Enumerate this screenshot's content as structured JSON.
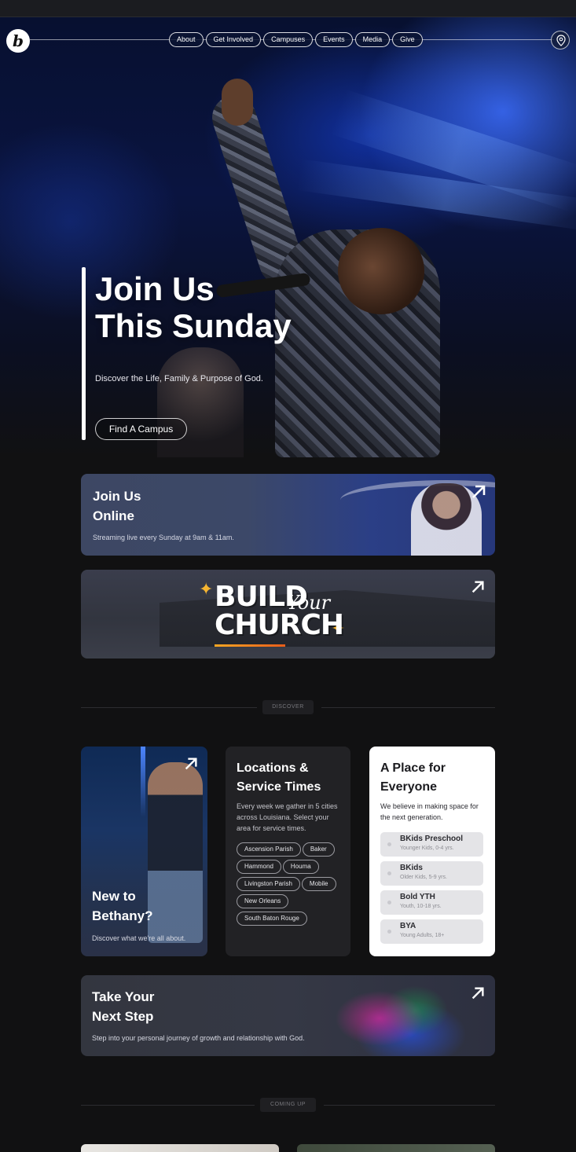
{
  "nav": {
    "logo_letter": "b",
    "items": [
      "About",
      "Get Involved",
      "Campuses",
      "Events",
      "Media",
      "Give"
    ],
    "location_icon": "map-pin-icon"
  },
  "hero": {
    "title_line1": "Join Us",
    "title_line2": "This Sunday",
    "subtitle": "Discover the Life, Family & Purpose of God.",
    "button_label": "Find A Campus"
  },
  "online_card": {
    "title_line1": "Join Us",
    "title_line2": "Online",
    "subtitle": "Streaming live every Sunday at 9am & 11am.",
    "arrow_icon": "arrow-up-right-icon"
  },
  "build_card": {
    "word1": "BUILD",
    "script": "Your",
    "word2": "CHURCH",
    "arrow_icon": "arrow-up-right-icon"
  },
  "discover_divider": {
    "label": "DISCOVER"
  },
  "new_card": {
    "title_line1": "New to",
    "title_line2": "Bethany?",
    "subtitle": "Discover what we're all about.",
    "arrow_icon": "arrow-up-right-icon"
  },
  "locations_card": {
    "title_line1": "Locations &",
    "title_line2": "Service Times",
    "description": "Every week we gather in 5 cities across Louisiana. Select your area for service times.",
    "tags": [
      "Ascension Parish",
      "Baker",
      "Hammond",
      "Houma",
      "Livingston Parish",
      "Mobile",
      "New Orleans",
      "South Baton Rouge"
    ]
  },
  "place_card": {
    "title_line1": "A Place for",
    "title_line2": "Everyone",
    "description": "We believe in making space for the next generation.",
    "groups": [
      {
        "name": "BKids Preschool",
        "sub": "Younger Kids, 0-4 yrs."
      },
      {
        "name": "BKids",
        "sub": "Older Kids, 5-9 yrs."
      },
      {
        "name": "Bold YTH",
        "sub": "Youth, 10-18 yrs."
      },
      {
        "name": "BYA",
        "sub": "Young Adults, 18+"
      }
    ]
  },
  "next_step_card": {
    "title_line1": "Take Your",
    "title_line2": "Next Step",
    "subtitle": "Step into your personal journey of growth and relationship with God.",
    "arrow_icon": "arrow-up-right-icon"
  },
  "coming_divider": {
    "label": "COMING UP"
  },
  "colors": {
    "page_bg": "#111112",
    "card_dark": "#222225",
    "card_light": "#ffffff",
    "accent_star": "#f6b531"
  }
}
